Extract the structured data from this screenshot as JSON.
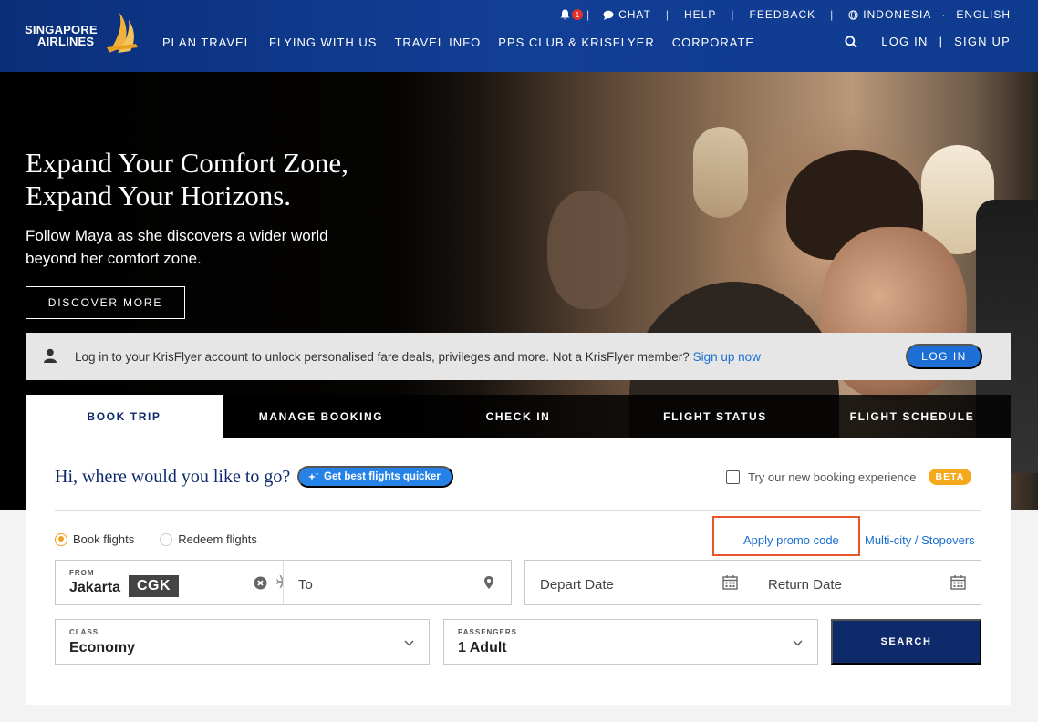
{
  "header": {
    "logo_line1": "SINGAPORE",
    "logo_line2": "AIRLINES",
    "notification_count": "1",
    "util": {
      "chat": "CHAT",
      "help": "HELP",
      "feedback": "FEEDBACK",
      "region": "INDONESIA",
      "language": "ENGLISH"
    },
    "nav": [
      "PLAN TRAVEL",
      "FLYING WITH US",
      "TRAVEL INFO",
      "PPS CLUB & KRISFLYER",
      "CORPORATE"
    ],
    "login": "LOG IN",
    "signup": "SIGN UP"
  },
  "hero": {
    "title": "Expand Your Comfort Zone,\nExpand Your Horizons.",
    "subtitle": "Follow Maya as she discovers a wider world beyond her comfort zone.",
    "cta": "DISCOVER MORE"
  },
  "banner": {
    "text": "Log in to your KrisFlyer account to unlock personalised fare deals, privileges and more. Not a KrisFlyer member?",
    "signup_link": "Sign up now",
    "login_button": "LOG IN"
  },
  "tabs": [
    {
      "label": "BOOK TRIP",
      "active": true
    },
    {
      "label": "MANAGE BOOKING",
      "active": false
    },
    {
      "label": "CHECK IN",
      "active": false
    },
    {
      "label": "FLIGHT STATUS",
      "active": false
    },
    {
      "label": "FLIGHT SCHEDULE",
      "active": false
    }
  ],
  "booking": {
    "greeting": "Hi, where would you like to go?",
    "quick_button": "Get best flights quicker",
    "try_new": "Try our new booking experience",
    "beta": "BETA",
    "radio_book": "Book flights",
    "radio_redeem": "Redeem flights",
    "promo": "Apply promo code",
    "multi_city": "Multi-city / Stopovers",
    "from_label": "FROM",
    "from_city": "Jakarta",
    "from_code": "CGK",
    "to_placeholder": "To",
    "depart_placeholder": "Depart Date",
    "return_placeholder": "Return Date",
    "class_label": "CLASS",
    "class_value": "Economy",
    "passengers_label": "PASSENGERS",
    "passengers_value": "1 Adult",
    "search_button": "SEARCH"
  },
  "colors": {
    "header_blue": "#123f96",
    "navy": "#0e2a6b",
    "accent_blue": "#1d6fd6",
    "beta_orange": "#f6a81c",
    "highlight_red": "#e8532a"
  }
}
